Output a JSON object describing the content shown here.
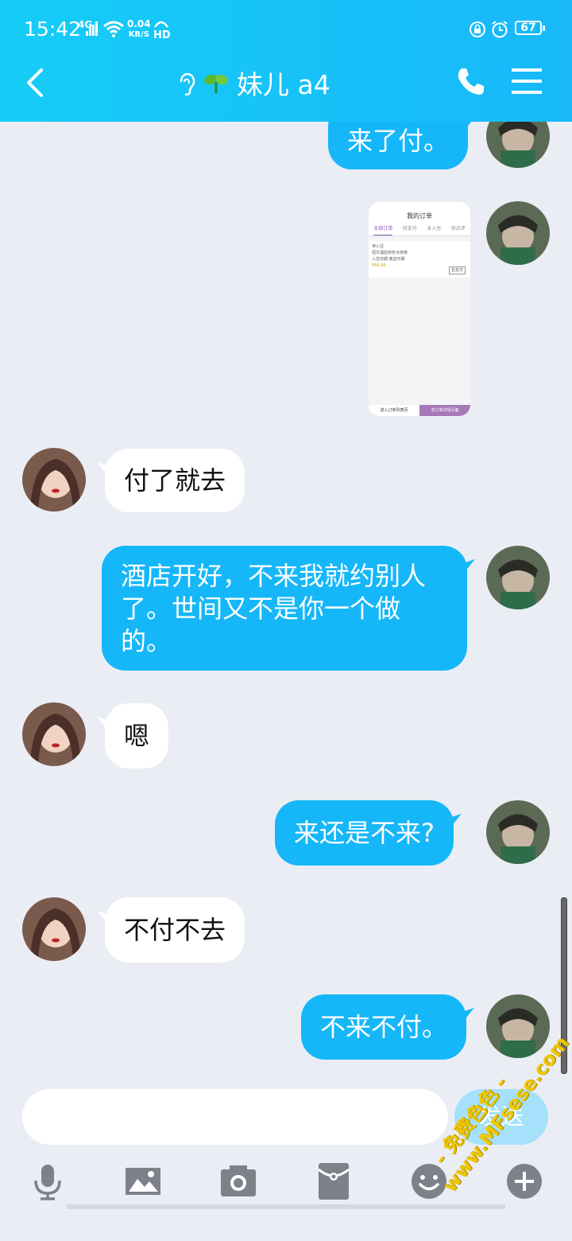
{
  "status_bar": {
    "time": "15:42",
    "network": "4G",
    "speed_value": "0.04",
    "speed_unit": "KB/S",
    "hd": "HD",
    "battery": "67"
  },
  "header": {
    "title": "妹儿 a4",
    "accent_color": "#16b7f8"
  },
  "messages": [
    {
      "from": "me",
      "text": "来了付。"
    },
    {
      "from": "me",
      "type": "image",
      "preview": {
        "title": "我的订单",
        "tabs": [
          "全部订单",
          "待支付",
          "未入住",
          "待点评"
        ],
        "card_line1": "待入住",
        "card_line2": "恒华酒店商务大床房",
        "card_line3": "入住日期 离店日期",
        "card_price": "¥56.00",
        "card_button": "去支付",
        "bottom_left": "进入订单列表页",
        "bottom_right": "去订单详情页面"
      }
    },
    {
      "from": "them",
      "text": "付了就去"
    },
    {
      "from": "me",
      "lines": [
        "酒店开好，不来我就约别人",
        "了。世间又不是你一个做",
        "的。"
      ]
    },
    {
      "from": "them",
      "text": "嗯"
    },
    {
      "from": "me",
      "text": "来还是不来?"
    },
    {
      "from": "them",
      "text": "不付不去"
    },
    {
      "from": "me",
      "text": "不来不付。"
    }
  ],
  "input": {
    "placeholder": "",
    "send_label": "发送"
  },
  "toolbar": {
    "icons": [
      "microphone-icon",
      "image-icon",
      "camera-icon",
      "red-packet-icon",
      "emoji-icon",
      "plus-icon"
    ]
  },
  "watermark": {
    "line1": "- 免费色色 -",
    "line2": "www.MFsese.com"
  }
}
